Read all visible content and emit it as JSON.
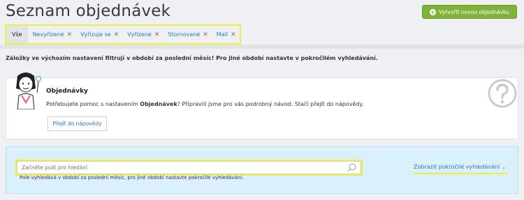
{
  "header": {
    "title": "Seznam objednávek",
    "create_button": "Vytvořit novou objednávku"
  },
  "tabs": [
    {
      "label": "Vše",
      "active": true,
      "closable": false
    },
    {
      "label": "Nevyřízené",
      "active": false,
      "closable": true
    },
    {
      "label": "Vyřizuje se",
      "active": false,
      "closable": true
    },
    {
      "label": "Vyřízené",
      "active": false,
      "closable": true
    },
    {
      "label": "Stornované",
      "active": false,
      "closable": true
    },
    {
      "label": "Mall",
      "active": false,
      "closable": true
    }
  ],
  "notice": "Záložky ve výchozím nastavení filtrují v období za poslední měsíc! Pro jiné období nastavte v pokročilém vyhledávání.",
  "help": {
    "title": "Objednávky",
    "text_before": "Potřebujete pomoc s nastavením ",
    "text_bold": "Objednávek",
    "text_after": "? Připravili jsme pro vás podrobný návod. Stačí přejít do nápovědy.",
    "button": "Přejít do nápovědy"
  },
  "search": {
    "placeholder": "Začněte psát pro hledání",
    "hint": "Pole vyhledává v období za poslední měsíc, pro jiné období nastavte pokročilé vyhledávání.",
    "advanced_link": "Zobrazit pokročilé vyhledávání"
  },
  "colors": {
    "accent_green": "#7fb338",
    "link_blue": "#2a78b8",
    "highlight_yellow": "#f1ee3b",
    "search_panel_bg": "#daf1fb"
  },
  "icons": {
    "create": "plus-circle-icon",
    "tab_close": "close-icon",
    "help": "question-circle-icon",
    "search": "search-icon",
    "chevron": "chevron-down-icon"
  }
}
